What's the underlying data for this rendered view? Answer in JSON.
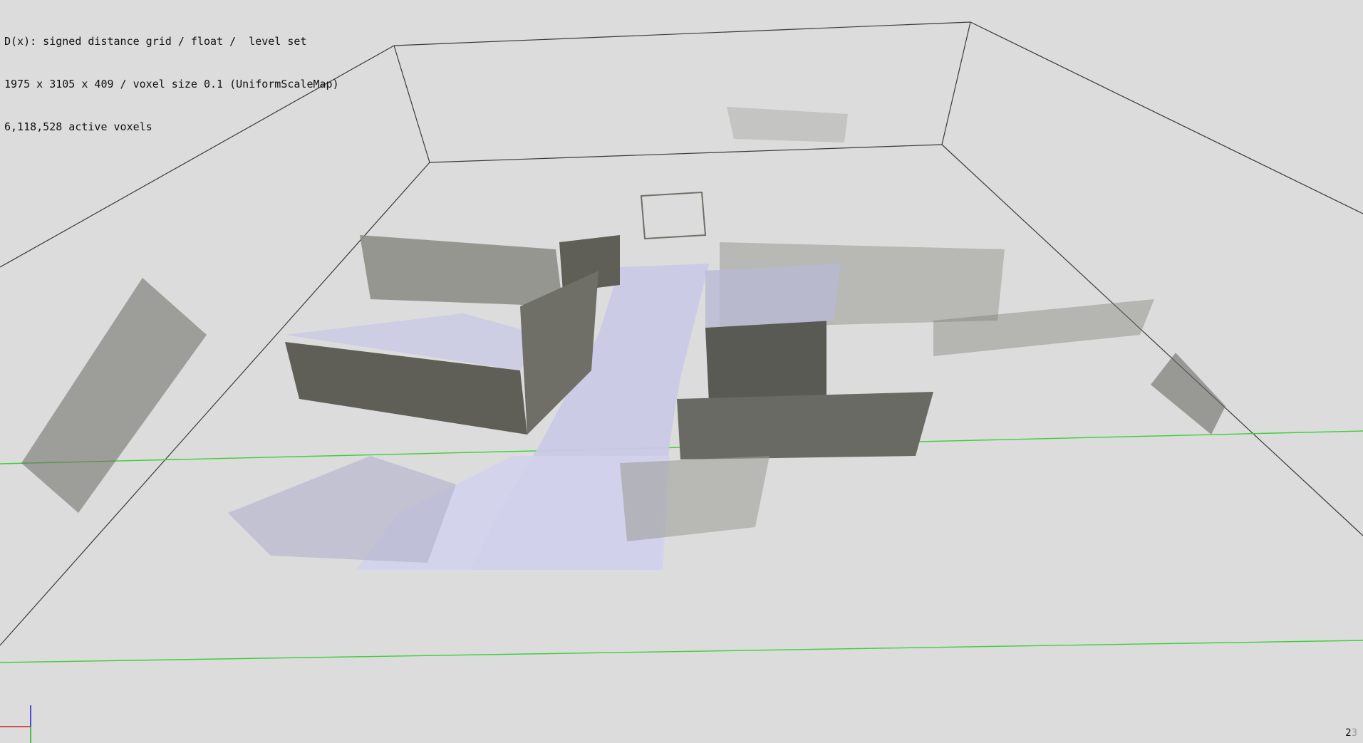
{
  "hud": {
    "line1": "D(x): signed distance grid / float /  level set",
    "line2": "1975 x 3105 x 409 / voxel size 0.1 (UniformScaleMap)",
    "line3": "6,118,528 active voxels"
  },
  "frame": {
    "digit": "2",
    "ghost": "3"
  },
  "colors": {
    "background": "#dcdcdc",
    "bbox": "#3a3a3a",
    "ground_line": "#39d039",
    "surface_light": "#c9c9e6",
    "surface_dark": "#6d6d66",
    "axis_x": "#d02020",
    "axis_y": "#20b020",
    "axis_z": "#2020d0"
  },
  "icons": {
    "axis_gizmo": "xyz-axis-icon"
  }
}
